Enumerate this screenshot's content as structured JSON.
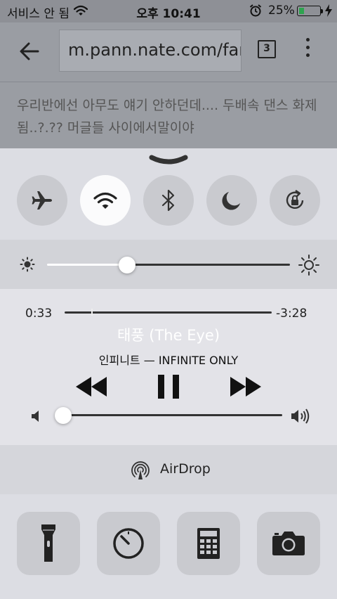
{
  "status_bar": {
    "carrier": "서비스 안 됨",
    "time": "오후 10:41",
    "battery_percent": "25%",
    "battery_level": 0.25,
    "battery_color": "#2ea44f",
    "icons": [
      "wifi-icon",
      "alarm-icon",
      "battery-icon",
      "charging-bolt-icon"
    ]
  },
  "browser": {
    "url": "m.pann.nate.com/fantalk",
    "tab_count": "3",
    "headline": "우리반에선 아무도 얘기 안하던데.... 두배속 댄스 화제됨..?.??  머글들 사이에서말이야",
    "icons": [
      "back-arrow-icon",
      "more-vert-icon"
    ]
  },
  "control_center": {
    "toggles": [
      {
        "name": "airplane-mode",
        "icon": "airplane-icon",
        "on": false
      },
      {
        "name": "wifi",
        "icon": "wifi-icon",
        "on": true
      },
      {
        "name": "bluetooth",
        "icon": "bluetooth-icon",
        "on": false
      },
      {
        "name": "do-not-disturb",
        "icon": "moon-icon",
        "on": false
      },
      {
        "name": "rotation-lock",
        "icon": "rotation-lock-icon",
        "on": false
      }
    ],
    "brightness_level": 0.33,
    "now_playing": {
      "elapsed": "0:33",
      "remaining": "-3:28",
      "progress": 0.13,
      "title": "태풍 (The Eye)",
      "subtitle": "인피니트 — INFINITE ONLY",
      "volume_level": 0.03
    },
    "airdrop_label": "AirDrop",
    "shortcuts": [
      {
        "name": "flashlight",
        "icon": "flashlight-icon"
      },
      {
        "name": "timer",
        "icon": "timer-icon"
      },
      {
        "name": "calculator",
        "icon": "calculator-icon"
      },
      {
        "name": "camera",
        "icon": "camera-icon"
      }
    ]
  }
}
